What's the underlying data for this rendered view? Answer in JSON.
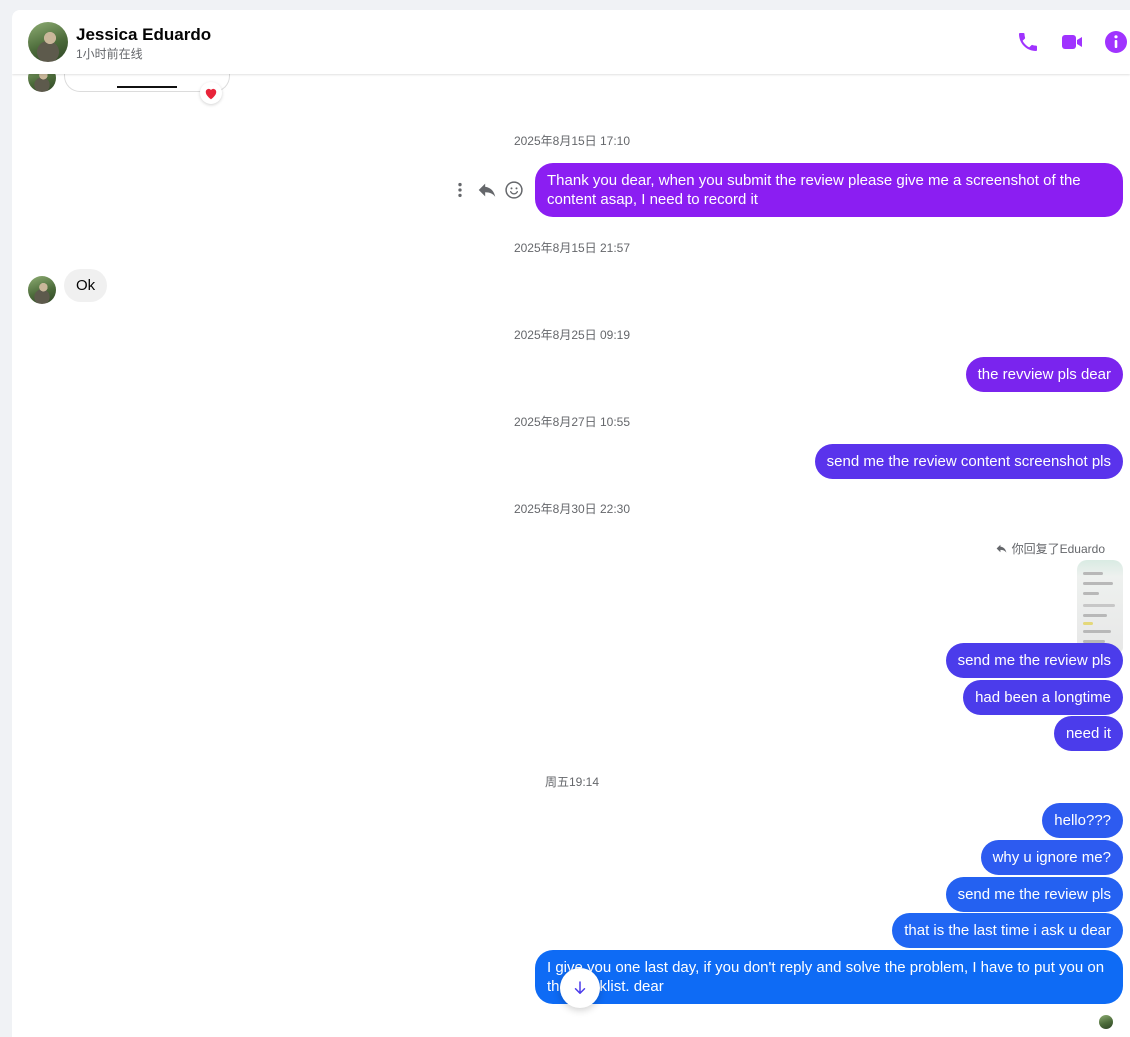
{
  "header": {
    "name": "Jessica Eduardo",
    "status": "1小时前在线",
    "icons": [
      "phone-icon",
      "video-camera-icon",
      "info-icon"
    ],
    "accent": "#a033ff"
  },
  "messages": {
    "ts1": "2025年8月15日 17:10",
    "m1": "Thank you dear, when you submit the review please give me a screenshot of the content asap, I need to record it",
    "ts2": "2025年8月15日 21:57",
    "in1": "Ok",
    "ts3": "2025年8月25日 09:19",
    "m2": "the revview pls dear",
    "ts4": "2025年8月27日 10:55",
    "m3": "send me the review content screenshot pls",
    "ts5": "2025年8月30日 22:30",
    "reply_note": "你回复了Eduardo",
    "m4": "send me the review pls",
    "m5": "had been a longtime",
    "m6": "need it",
    "ts6": "周五19:14",
    "m7": "hello???",
    "m8": "why u ignore me?",
    "m9": "send me the review pls",
    "m10": "that is the last time i ask u dear",
    "m11": "I give you one last day, if you don't reply and solve the problem, I have to put you on the blacklist. dear"
  },
  "reaction": "heart-emoji",
  "colors": {
    "purple": "#8b1ef2",
    "violet": "#6b2bea",
    "indigo": "#4b3ceb",
    "blue": "#2d5bf0",
    "blue2": "#0e6bf5"
  }
}
